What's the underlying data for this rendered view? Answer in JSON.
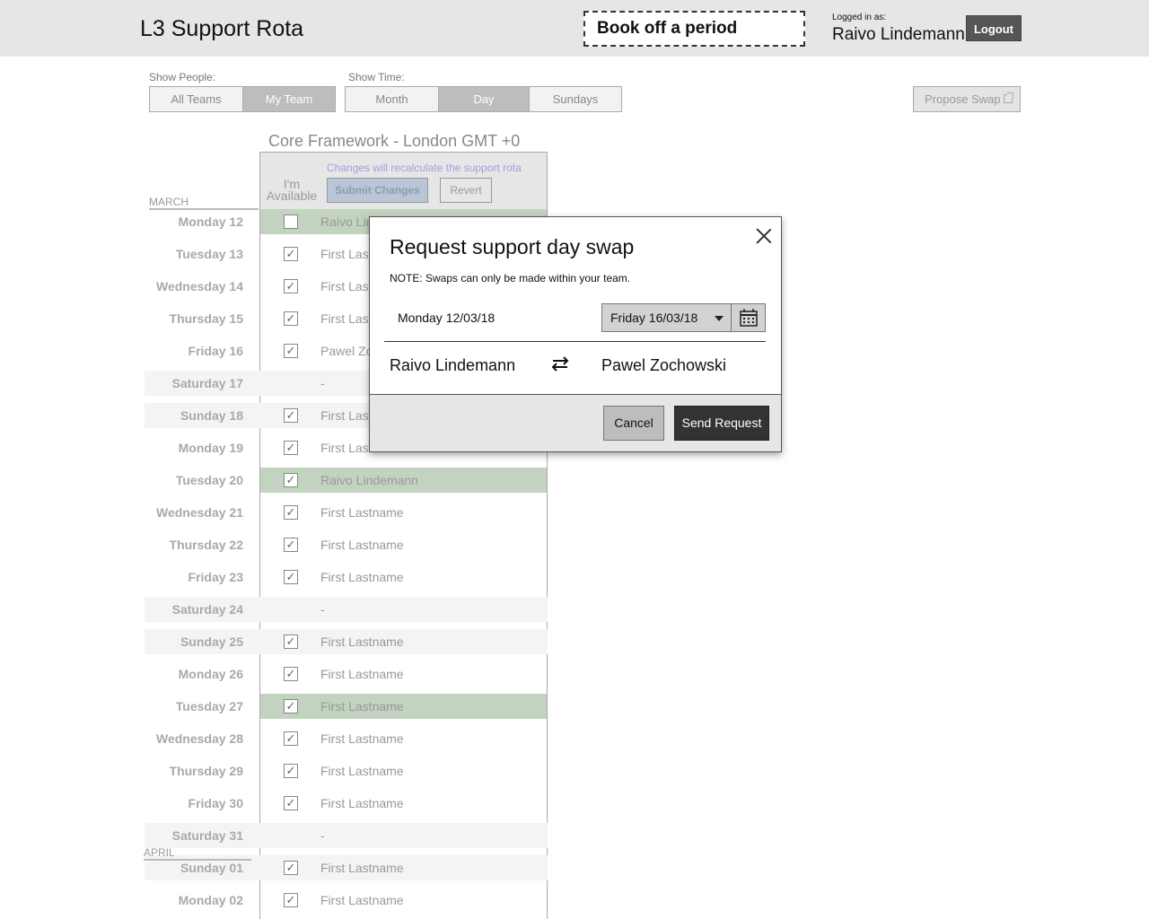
{
  "header": {
    "app_title": "L3 Support Rota",
    "book_off": "Book off a period",
    "logged_in_label": "Logged in as:",
    "user_name": "Raivo Lindemann",
    "logout": "Logout"
  },
  "controls": {
    "show_people_label": "Show People:",
    "people_options": [
      "All Teams",
      "My Team"
    ],
    "people_selected": "My Team",
    "show_time_label": "Show Time:",
    "time_options": [
      "Month",
      "Day",
      "Sundays"
    ],
    "time_selected": "Day",
    "propose_swap": "Propose Swap"
  },
  "rota": {
    "team_title": "Core Framework - London GMT +0",
    "recalc_note": "Changes will recalculate the support rota",
    "available_label": "I'm Available",
    "submit": "Submit Changes",
    "revert": "Revert",
    "months": [
      "MARCH",
      "APRIL"
    ],
    "rows": [
      {
        "day": "Monday 12",
        "name": "Raivo Lindemann",
        "checked": false,
        "weekend": false,
        "mine": true
      },
      {
        "day": "Tuesday 13",
        "name": "First Lastname",
        "checked": true,
        "weekend": false,
        "mine": false
      },
      {
        "day": "Wednesday 14",
        "name": "First Lastname",
        "checked": true,
        "weekend": false,
        "mine": false
      },
      {
        "day": "Thursday 15",
        "name": "First Lastname",
        "checked": true,
        "weekend": false,
        "mine": false
      },
      {
        "day": "Friday 16",
        "name": "Pawel Zochowski",
        "checked": true,
        "weekend": false,
        "mine": false
      },
      {
        "day": "Saturday 17",
        "name": "-",
        "checked": null,
        "weekend": true,
        "mine": false
      },
      {
        "day": "Sunday 18",
        "name": "First Lastname",
        "checked": true,
        "weekend": true,
        "mine": false
      },
      {
        "day": "Monday 19",
        "name": "First Lastname",
        "checked": true,
        "weekend": false,
        "mine": false
      },
      {
        "day": "Tuesday 20",
        "name": "Raivo Lindemann",
        "checked": true,
        "weekend": false,
        "mine": true
      },
      {
        "day": "Wednesday 21",
        "name": "First Lastname",
        "checked": true,
        "weekend": false,
        "mine": false
      },
      {
        "day": "Thursday 22",
        "name": "First Lastname",
        "checked": true,
        "weekend": false,
        "mine": false
      },
      {
        "day": "Friday 23",
        "name": "First Lastname",
        "checked": true,
        "weekend": false,
        "mine": false
      },
      {
        "day": "Saturday 24",
        "name": "-",
        "checked": null,
        "weekend": true,
        "mine": false
      },
      {
        "day": "Sunday 25",
        "name": "First Lastname",
        "checked": true,
        "weekend": true,
        "mine": false
      },
      {
        "day": "Monday 26",
        "name": "First Lastname",
        "checked": true,
        "weekend": false,
        "mine": false
      },
      {
        "day": "Tuesday 27",
        "name": "First Lastname",
        "checked": true,
        "weekend": false,
        "mine": true
      },
      {
        "day": "Wednesday 28",
        "name": "First Lastname",
        "checked": true,
        "weekend": false,
        "mine": false
      },
      {
        "day": "Thursday 29",
        "name": "First Lastname",
        "checked": true,
        "weekend": false,
        "mine": false
      },
      {
        "day": "Friday 30",
        "name": "First Lastname",
        "checked": true,
        "weekend": false,
        "mine": false
      },
      {
        "day": "Saturday 31",
        "name": "-",
        "checked": null,
        "weekend": true,
        "mine": false
      },
      {
        "day": "Sunday 01",
        "name": "First Lastname",
        "checked": true,
        "weekend": true,
        "mine": false
      },
      {
        "day": "Monday 02",
        "name": "First Lastname",
        "checked": true,
        "weekend": false,
        "mine": false
      }
    ]
  },
  "modal": {
    "title": "Request support day swap",
    "note": "NOTE: Swaps can only be made within your team.",
    "from_date": "Monday 12/03/18",
    "to_date": "Friday 16/03/18",
    "person_from": "Raivo Lindemann",
    "person_to": "Pawel Zochowski",
    "cancel": "Cancel",
    "send": "Send Request"
  },
  "colors": {
    "own_shift_highlight": "#c2d4bf",
    "weekend_row": "#f4f4f4",
    "primary_button": "#333333",
    "recalc_note": "#a99ae0"
  }
}
